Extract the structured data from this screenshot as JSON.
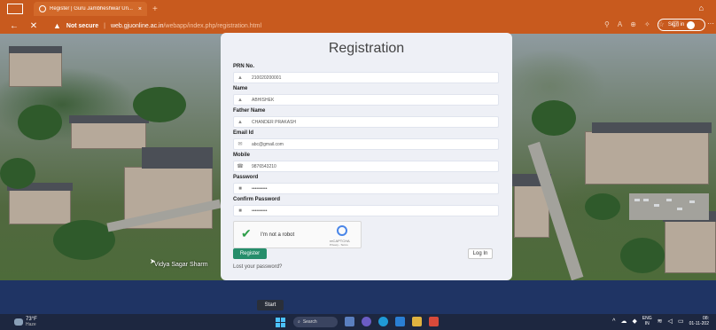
{
  "browser": {
    "tab_title": "Register | Guru Jambheshwar Un...",
    "tab_close": "×",
    "new_tab": "+",
    "security_warning": "Not secure",
    "url_separator": "|",
    "url_host": "web.gjuonline.ac.in",
    "url_path": "/webapp/index.php/registration.html",
    "signin_label": "Sign in",
    "nav_back": "←",
    "nav_close": "✕",
    "more": "···"
  },
  "page": {
    "title": "Registration",
    "photo_caption": "Vidya Sagar Sharm",
    "fields": [
      {
        "label": "PRN No.",
        "value": "210020200001",
        "icon": "person-icon"
      },
      {
        "label": "Name",
        "value": "ABHISHEK",
        "icon": "person-icon"
      },
      {
        "label": "Father Name",
        "value": "CHANDER PRAKASH",
        "icon": "person-icon"
      },
      {
        "label": "Email Id",
        "value": "abc@gmail.com",
        "icon": "envelope-icon"
      },
      {
        "label": "Mobile",
        "value": "9876543210",
        "icon": "phone-icon"
      },
      {
        "label": "Password",
        "value": "••••••••••",
        "icon": "lock-icon"
      },
      {
        "label": "Confirm Password",
        "value": "••••••••••",
        "icon": "lock-icon"
      }
    ],
    "captcha": {
      "label": "I'm not a robot",
      "brand": "reCAPTCHA",
      "links": "Privacy - Terms"
    },
    "register_button": "Register",
    "login_button": "Log In",
    "lost_password": "Lost your password?"
  },
  "taskbar": {
    "start_tooltip": "Start",
    "weather_temp": "73°F",
    "weather_desc": "Haze",
    "search_label": "Search",
    "lang_top": "ENG",
    "lang_bottom": "IN",
    "time": "08:",
    "date": "01-11-202"
  }
}
